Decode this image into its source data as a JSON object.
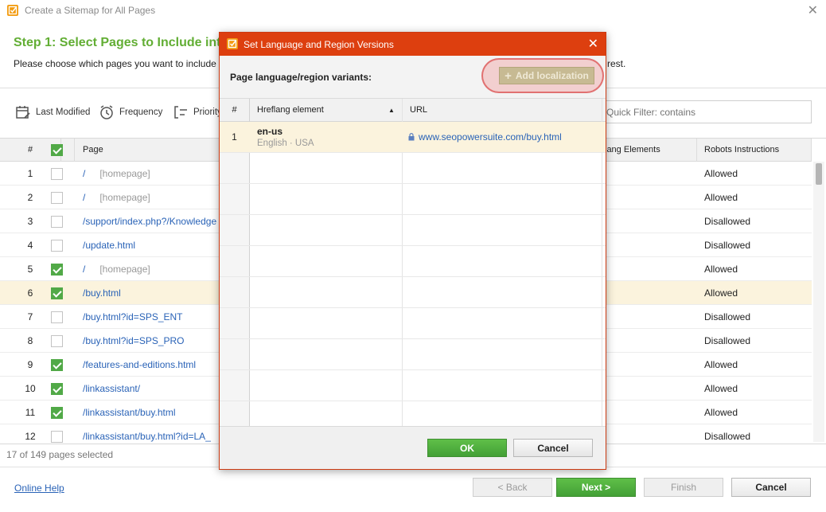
{
  "window": {
    "title": "Create a Sitemap for All Pages"
  },
  "step": {
    "title": "Step 1: Select Pages to Include int",
    "description": "Please choose which pages you want to include",
    "description_rest": "rest."
  },
  "toolbar": {
    "last_modified": "Last Modified",
    "frequency": "Frequency",
    "priority": "Priority",
    "quick_filter_placeholder": "Quick Filter: contains"
  },
  "table": {
    "headers": {
      "num": "#",
      "page": "Page",
      "hreflang": "lang Elements",
      "robots": "Robots Instructions"
    },
    "rows": [
      {
        "num": "1",
        "checked": false,
        "page": "/",
        "note": "[homepage]",
        "robots": "Allowed"
      },
      {
        "num": "2",
        "checked": false,
        "page": "/",
        "note": "[homepage]",
        "robots": "Allowed"
      },
      {
        "num": "3",
        "checked": false,
        "page": "/support/index.php?/Knowledge",
        "note": "",
        "robots": "Disallowed"
      },
      {
        "num": "4",
        "checked": false,
        "page": "/update.html",
        "note": "",
        "robots": "Disallowed"
      },
      {
        "num": "5",
        "checked": true,
        "page": "/",
        "note": "[homepage]",
        "robots": "Allowed"
      },
      {
        "num": "6",
        "checked": true,
        "page": "/buy.html",
        "note": "",
        "robots": "Allowed",
        "selected": true
      },
      {
        "num": "7",
        "checked": false,
        "page": "/buy.html?id=SPS_ENT",
        "note": "",
        "robots": "Disallowed"
      },
      {
        "num": "8",
        "checked": false,
        "page": "/buy.html?id=SPS_PRO",
        "note": "",
        "robots": "Disallowed"
      },
      {
        "num": "9",
        "checked": true,
        "page": "/features-and-editions.html",
        "note": "",
        "robots": "Allowed"
      },
      {
        "num": "10",
        "checked": true,
        "page": "/linkassistant/",
        "note": "",
        "robots": "Allowed"
      },
      {
        "num": "11",
        "checked": true,
        "page": "/linkassistant/buy.html",
        "note": "",
        "robots": "Allowed"
      },
      {
        "num": "12",
        "checked": false,
        "page": "/linkassistant/buy.html?id=LA_",
        "note": "",
        "robots": "Disallowed"
      }
    ]
  },
  "status": {
    "pages_selected": "17 of 149 pages selected"
  },
  "footer": {
    "online_help": "Online Help",
    "back": "< Back",
    "next": "Next >",
    "finish": "Finish",
    "cancel": "Cancel"
  },
  "dialog": {
    "title": "Set Language and Region Versions",
    "variants_label": "Page language/region variants:",
    "add_localization": "Add localization",
    "headers": {
      "num": "#",
      "hreflang": "Hreflang element",
      "url": "URL"
    },
    "rows": [
      {
        "num": "1",
        "code": "en-us",
        "desc": "English · USA",
        "url": "www.seopowersuite.com/buy.html"
      }
    ],
    "ok": "OK",
    "cancel": "Cancel"
  },
  "colors": {
    "accent_green": "#62ae34",
    "dialog_red": "#dd3f0f",
    "link_blue": "#2a63b7",
    "selection": "#fbf3dd"
  }
}
